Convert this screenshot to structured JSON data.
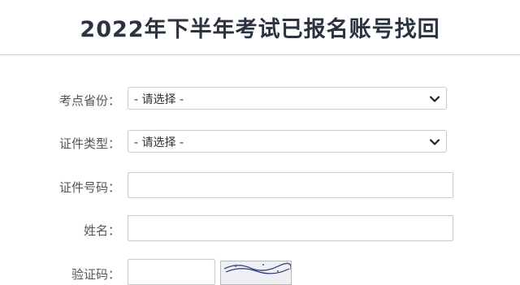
{
  "page": {
    "title": "2022年下半年考试已报名账号找回"
  },
  "form": {
    "province": {
      "label": "考点省份：",
      "selected": "- 请选择 -"
    },
    "id_type": {
      "label": "证件类型：",
      "selected": "- 请选择 -"
    },
    "id_number": {
      "label": "证件号码：",
      "value": ""
    },
    "name": {
      "label": "姓名：",
      "value": ""
    },
    "captcha": {
      "label": "验证码：",
      "value": ""
    }
  },
  "icons": {
    "dropdown": "chevron-down-icon"
  }
}
